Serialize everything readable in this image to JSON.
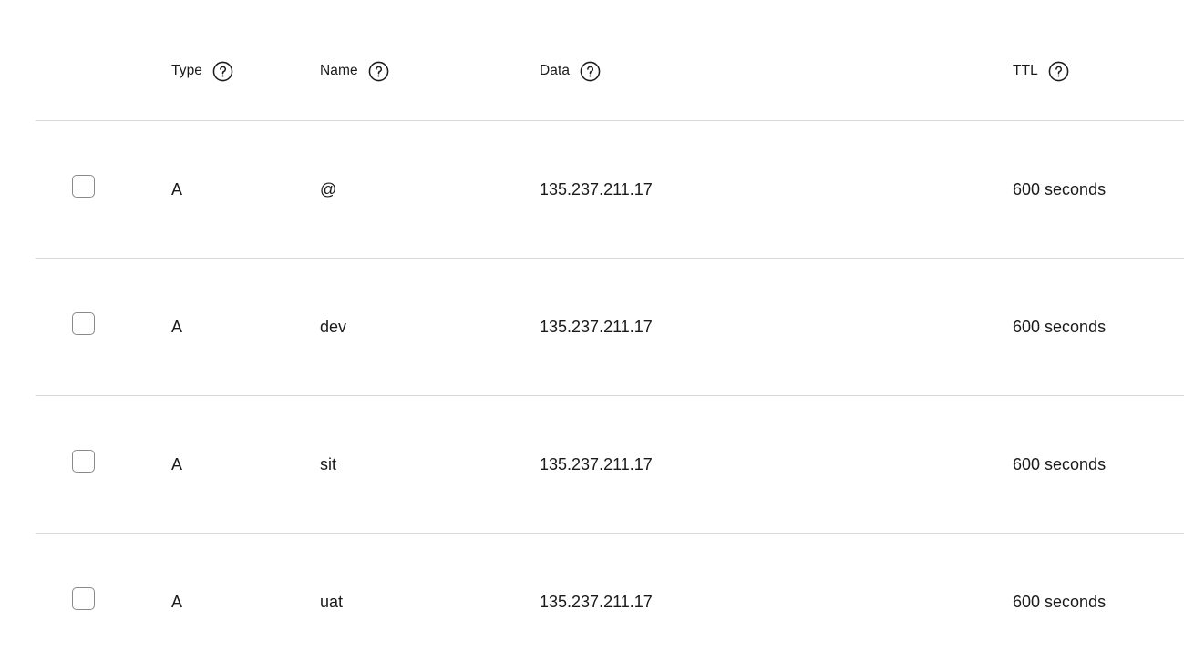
{
  "header": {
    "type_label": "Type",
    "name_label": "Name",
    "data_label": "Data",
    "ttl_label": "TTL",
    "help_icon": "question-circle-icon"
  },
  "records": [
    {
      "checked": false,
      "type": "A",
      "name": "@",
      "data": "135.237.211.17",
      "ttl": "600 seconds"
    },
    {
      "checked": false,
      "type": "A",
      "name": "dev",
      "data": "135.237.211.17",
      "ttl": "600 seconds"
    },
    {
      "checked": false,
      "type": "A",
      "name": "sit",
      "data": "135.237.211.17",
      "ttl": "600 seconds"
    },
    {
      "checked": false,
      "type": "A",
      "name": "uat",
      "data": "135.237.211.17",
      "ttl": "600 seconds"
    }
  ],
  "colors": {
    "divider": "#d9d9d9",
    "text": "#1a1a1a",
    "checkbox_border": "#8a8a8a"
  }
}
